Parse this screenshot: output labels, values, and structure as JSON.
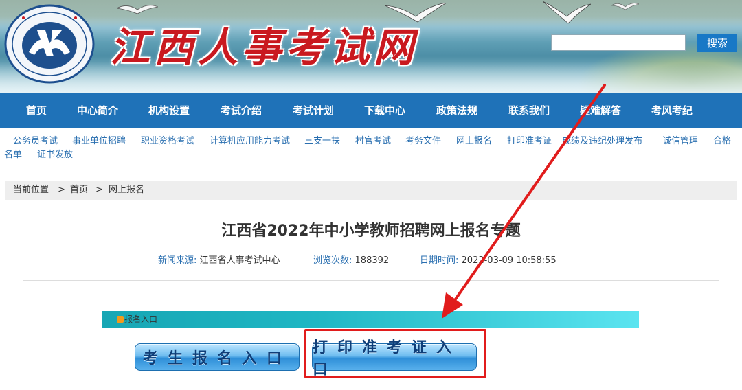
{
  "header": {
    "site_title": "江西人事考试网",
    "search_placeholder": "",
    "search_button": "搜索",
    "colors": {
      "title_red": "#c9191f",
      "nav_blue": "#1f72b8",
      "search_blue": "#1878c6"
    }
  },
  "nav": {
    "items": [
      "首页",
      "中心简介",
      "机构设置",
      "考试介绍",
      "考试计划",
      "下载中心",
      "政策法规",
      "联系我们",
      "疑难解答",
      "考风考纪"
    ]
  },
  "subnav": {
    "items": [
      "公务员考试",
      "事业单位招聘",
      "职业资格考试",
      "计算机应用能力考试",
      "三支一扶",
      "村官考试",
      "考务文件",
      "网上报名",
      "打印准考证",
      "成绩及违纪处理发布",
      "诚信管理",
      "合格",
      "名单",
      "证书发放"
    ]
  },
  "breadcrumb": {
    "label": "当前位置",
    "sep": ">",
    "home": "首页",
    "current": "网上报名"
  },
  "article": {
    "title": "江西省2022年中小学教师招聘网上报名专题",
    "source_label": "新闻来源:",
    "source_value": "江西省人事考试中心",
    "views_label": "浏览次数:",
    "views_value": "188392",
    "date_label": "日期时间:",
    "date_value": "2022-03-09 10:58:55"
  },
  "registration": {
    "section_label": "报名入口",
    "register_button": "考生报名入口",
    "print_button": "打印准考证入口"
  },
  "annotation": {
    "highlight_color": "#e11c1c"
  }
}
